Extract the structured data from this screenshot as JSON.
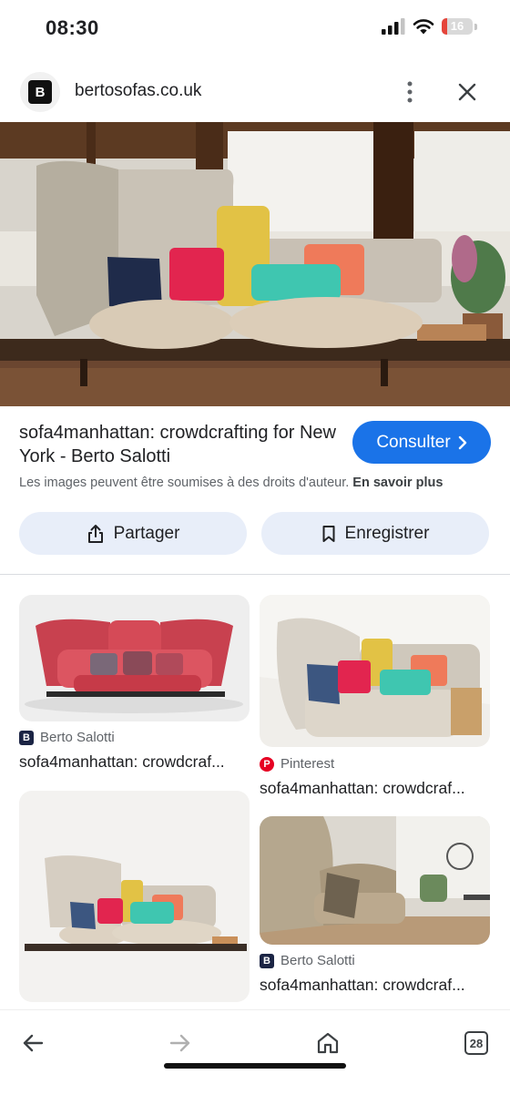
{
  "status": {
    "time": "08:30",
    "battery": "16"
  },
  "url_bar": {
    "favicon_letter": "B",
    "domain": "bertosofas.co.uk"
  },
  "result": {
    "title": "sofa4manhattan: crowdcrafting for New York - Berto Salotti",
    "visit_label": "Consulter",
    "copyright_text": "Les images peuvent être soumises à des droits d'auteur.",
    "learn_more": "En savoir plus",
    "share_label": "Partager",
    "save_label": "Enregistrer"
  },
  "related": [
    {
      "source": "Berto Salotti",
      "source_icon": "B",
      "caption": "sofa4manhattan: crowdcraf..."
    },
    {
      "source": "Pinterest",
      "source_icon": "pinterest-icon",
      "caption": "sofa4manhattan: crowdcraf..."
    },
    {
      "source": "",
      "source_icon": "",
      "caption": ""
    },
    {
      "source": "Berto Salotti",
      "source_icon": "B",
      "caption": "sofa4manhattan: crowdcraf..."
    }
  ],
  "bottom_nav": {
    "tab_count": "28"
  },
  "colors": {
    "accent": "#1a73e8",
    "action_bg": "#e8eef9",
    "pinterest": "#e60023"
  }
}
